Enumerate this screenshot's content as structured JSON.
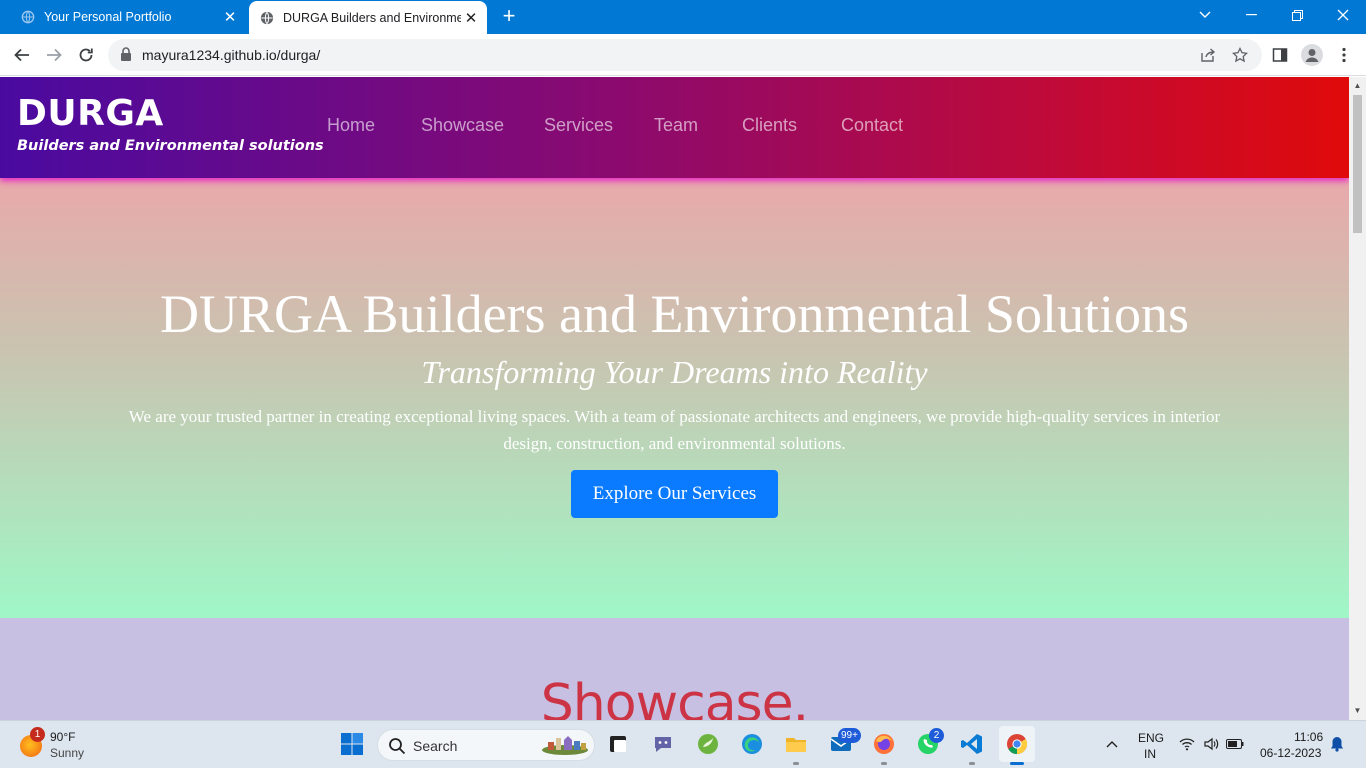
{
  "browser": {
    "tabs": [
      {
        "title": "Your Personal Portfolio",
        "active": false
      },
      {
        "title": "DURGA Builders and Environme",
        "active": true
      }
    ],
    "url": "mayura1234.github.io/durga/"
  },
  "site": {
    "brand": {
      "name": "DURGA",
      "tagline": "Builders and Environmental solutions"
    },
    "nav": [
      "Home",
      "Showcase",
      "Services",
      "Team",
      "Clients",
      "Contact"
    ],
    "hero": {
      "title": "DURGA Builders and Environmental Solutions",
      "subtitle": "Transforming Your Dreams into Reality",
      "description": "We are your trusted partner in creating exceptional living spaces. With a team of passionate architects and engineers, we provide high-quality services in interior design, construction, and environmental solutions.",
      "cta": "Explore Our Services"
    },
    "showcase_title": "Showcase."
  },
  "taskbar": {
    "weather": {
      "badge": "1",
      "temp": "90°F",
      "condition": "Sunny"
    },
    "search_placeholder": "Search",
    "mail_badge": "99+",
    "whatsapp_badge": "2",
    "language": {
      "line1": "ENG",
      "line2": "IN"
    },
    "clock": {
      "time": "11:06",
      "date": "06-12-2023"
    }
  },
  "colors": {
    "titlebar": "#0078d4",
    "header_start": "#4a0aa0",
    "header_end": "#e00a0a",
    "cta": "#0a7bff",
    "showcase_title": "#cc3344"
  }
}
